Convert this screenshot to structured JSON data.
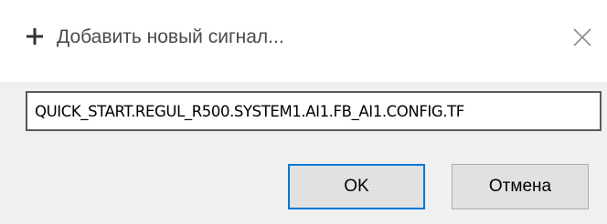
{
  "dialog": {
    "title": "Добавить новый сигнал...",
    "title_icon": "plus-icon",
    "close_icon": "close-icon"
  },
  "signal_input": {
    "value": "QUICK_START.REGUL_R500.SYSTEM1.AI1.FB_AI1.CONFIG.TF"
  },
  "buttons": {
    "ok_label": "OK",
    "cancel_label": "Отмена"
  },
  "colors": {
    "title_bar": "#ffffff",
    "body": "#f0f0f0",
    "focus_border": "#0078d7",
    "button_face": "#e1e1e1"
  }
}
